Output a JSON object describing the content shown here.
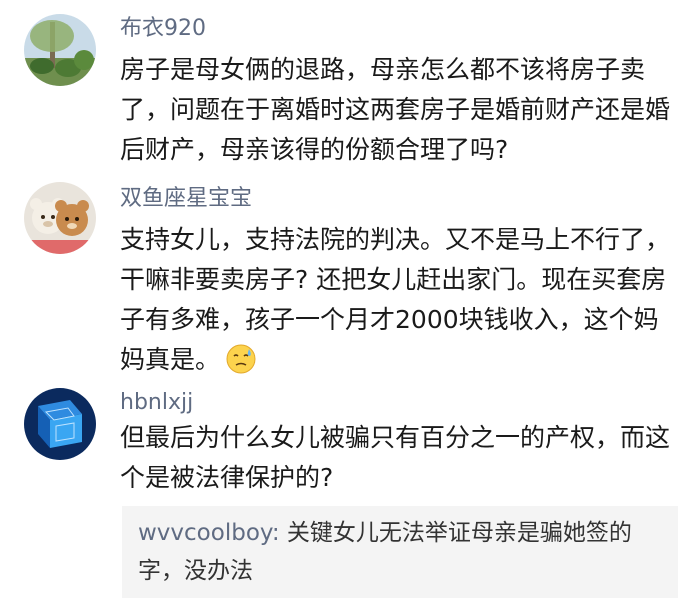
{
  "comments": [
    {
      "username": "布衣920",
      "avatar": "landscape-tree-avatar",
      "lines": [
        "房子是母女俩的退路，母亲怎么都不该将房子卖",
        "了，问题在于离婚时这两套房子是婚前财产还是婚",
        "后财产，母亲该得的份额合理了吗?"
      ]
    },
    {
      "username": "双鱼座星宝宝",
      "avatar": "teddy-bears-avatar",
      "lines": [
        "支持女儿，支持法院的判决。又不是马上不行了，",
        "干嘛非要卖房子? 还把女儿赶出家门。现在买套房",
        "子有多难，孩子一个月才2000块钱收入，这个妈",
        "妈真是。"
      ],
      "emoji": "sweat-emoji"
    },
    {
      "username": "hbnlxjj",
      "avatar": "blue-cube-avatar",
      "lines": [
        "但最后为什么女儿被骗只有百分之一的产权，而这",
        "个是被法律保护的?"
      ],
      "reply": {
        "author": "wvvcoolboy:",
        "line1": " 关键女儿无法举证母亲是骗她签的",
        "line2": "字，没办法"
      }
    }
  ],
  "colors": {
    "username": "#5f6b82",
    "text": "#1a1a1a",
    "reply_background": "#f4f4f4"
  }
}
